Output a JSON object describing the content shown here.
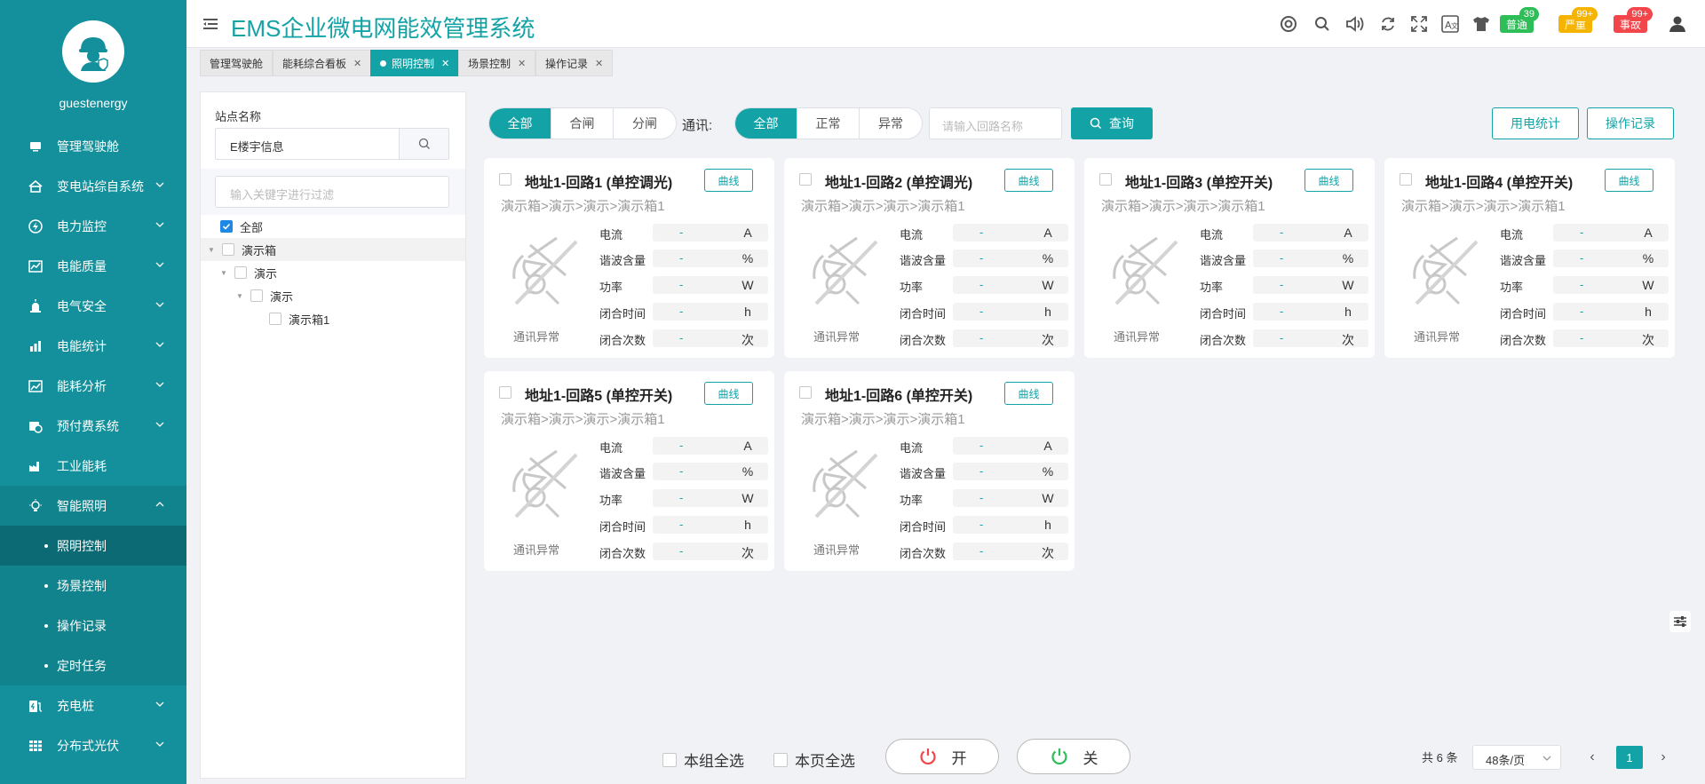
{
  "app": {
    "title": "EMS企业微电网能效管理系统",
    "username": "guestenergy"
  },
  "header": {
    "badges": [
      {
        "label": "普通",
        "count": "39",
        "color": "#2dbe58",
        "count_color": "#2dbe58"
      },
      {
        "label": "严重",
        "count": "99+",
        "color": "#f4b400",
        "count_color": "#f4b400"
      },
      {
        "label": "事故",
        "count": "99+",
        "color": "#f2464b",
        "count_color": "#f2464b"
      }
    ]
  },
  "sidebar": {
    "items": [
      {
        "label": "管理驾驶舱",
        "icon": "monitor-icon"
      },
      {
        "label": "变电站综自系统",
        "icon": "home-icon"
      },
      {
        "label": "电力监控",
        "icon": "lightning-icon"
      },
      {
        "label": "电能质量",
        "icon": "chart-icon"
      },
      {
        "label": "电气安全",
        "icon": "alarm-icon"
      },
      {
        "label": "电能统计",
        "icon": "bar-chart-icon"
      },
      {
        "label": "能耗分析",
        "icon": "analysis-icon"
      },
      {
        "label": "预付费系统",
        "icon": "wallet-icon"
      },
      {
        "label": "工业能耗",
        "icon": "factory-icon"
      },
      {
        "label": "智能照明",
        "icon": "bulb-icon"
      }
    ],
    "sub_items": [
      {
        "label": "照明控制"
      },
      {
        "label": "场景控制"
      },
      {
        "label": "操作记录"
      },
      {
        "label": "定时任务"
      }
    ],
    "after_items": [
      {
        "label": "充电桩",
        "icon": "charger-icon"
      },
      {
        "label": "分布式光伏",
        "icon": "solar-icon"
      }
    ]
  },
  "tabs": [
    {
      "label": "管理驾驶舱"
    },
    {
      "label": "能耗综合看板"
    },
    {
      "label": "照明控制"
    },
    {
      "label": "场景控制"
    },
    {
      "label": "操作记录"
    }
  ],
  "tree": {
    "station_label": "站点名称",
    "station_value": "E楼宇信息",
    "filter_placeholder": "输入关键字进行过滤",
    "nodes": {
      "all": "全部",
      "box": "演示箱",
      "demo1": "演示",
      "demo2": "演示",
      "box1": "演示箱1"
    }
  },
  "filters": {
    "state": [
      "全部",
      "合闸",
      "分闸"
    ],
    "comm_label": "通讯:",
    "comm": [
      "全部",
      "正常",
      "异常"
    ],
    "search_placeholder": "请输入回路名称",
    "query_label": "查询",
    "stat_label": "用电统计",
    "record_label": "操作记录"
  },
  "card_common": {
    "curve_label": "曲线",
    "path": "演示箱>演示>演示>演示箱1",
    "status": "通讯异常",
    "metrics": [
      {
        "name": "电流",
        "value": "-",
        "unit": "A"
      },
      {
        "name": "谐波含量",
        "value": "-",
        "unit": "%"
      },
      {
        "name": "功率",
        "value": "-",
        "unit": "W"
      },
      {
        "name": "闭合时间",
        "value": "-",
        "unit": "h"
      },
      {
        "name": "闭合次数",
        "value": "-",
        "unit": "次"
      }
    ]
  },
  "cards": [
    {
      "title": "地址1-回路1 (单控调光)"
    },
    {
      "title": "地址1-回路2 (单控调光)"
    },
    {
      "title": "地址1-回路3 (单控开关)"
    },
    {
      "title": "地址1-回路4 (单控开关)"
    },
    {
      "title": "地址1-回路5 (单控开关)"
    },
    {
      "title": "地址1-回路6 (单控开关)"
    }
  ],
  "footer": {
    "group_all": "本组全选",
    "page_all": "本页全选",
    "on_label": "开",
    "off_label": "关",
    "total": "共 6 条",
    "page_size": "48条/页",
    "page": "1"
  },
  "colors": {
    "accent": "#13a3a6",
    "sidebar": "#13909b"
  }
}
